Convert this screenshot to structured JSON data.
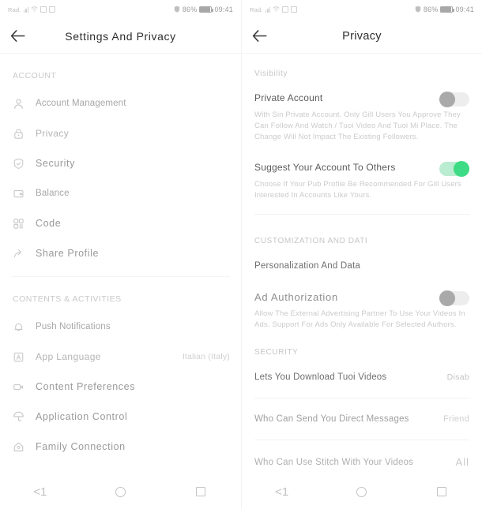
{
  "status_bar": {
    "carrier": "Rad.",
    "battery_percent": "86%",
    "time": "09:41",
    "icons": [
      "signal-bars-icon",
      "wifi-icon",
      "mail-icon",
      "calendar-icon",
      "shield-icon",
      "battery-icon"
    ]
  },
  "settings_screen": {
    "title": "Settings And Privacy",
    "back_icon": "back-arrow-icon",
    "sections": [
      {
        "label": "ACCOUNT",
        "items": [
          {
            "icon": "person-icon",
            "label": "Account Management",
            "value": ""
          },
          {
            "icon": "lock-icon",
            "label": "Privacy",
            "value": ""
          },
          {
            "icon": "shield-check-icon",
            "label": "Security",
            "value": ""
          },
          {
            "icon": "wallet-icon",
            "label": "Balance",
            "value": ""
          },
          {
            "icon": "qr-code-icon",
            "label": "Code",
            "value": ""
          },
          {
            "icon": "share-arrow-icon",
            "label": "Share Profile",
            "value": ""
          }
        ]
      },
      {
        "label": "CONTENTS & ACTIVITIES",
        "items": [
          {
            "icon": "bell-icon",
            "label": "Push Notifications",
            "value": ""
          },
          {
            "icon": "language-icon",
            "label": "App Language",
            "value": "Italian (Italy)"
          },
          {
            "icon": "video-camera-icon",
            "label": "Content Preferences",
            "value": ""
          },
          {
            "icon": "umbrella-icon",
            "label": "Application Control",
            "value": ""
          },
          {
            "icon": "home-icon",
            "label": "Family Connection",
            "value": ""
          }
        ]
      }
    ]
  },
  "privacy_screen": {
    "title": "Privacy",
    "back_icon": "back-arrow-icon",
    "sections": [
      {
        "label": "Visibility",
        "toggles": [
          {
            "title": "Private Account",
            "description": "With Sin Private Account. Only Gill Users You Approve They Can Follow And Watch / Tuoi Video And Tuoi Mi Place. The Change Will Not Impact The Existing Followers.",
            "state": "off"
          },
          {
            "title": "Suggest Your Account To Others",
            "description": "Choose If Your Pub Profile Be Recommended For Gill Users Interested In Accounts Like Yours.",
            "state": "on"
          }
        ]
      },
      {
        "label": "CUSTOMIZATION AND DATI",
        "items": [
          {
            "label": "Personalization And Data",
            "value": ""
          }
        ],
        "toggles": [
          {
            "title": "Ad Authorization",
            "description": "Allow The External Advertising Partner To Use Your Videos In Ads. Support For Ads Only Available For Selected Authors.",
            "state": "off"
          }
        ]
      },
      {
        "label": "SECURITY",
        "items": [
          {
            "label": "Lets You Download Tuoi Videos",
            "value": "Disab"
          },
          {
            "label": "Who Can Send You Direct Messages",
            "value": "Friend"
          },
          {
            "label": "Who Can Use Stitch With Your Videos",
            "value": "All"
          }
        ]
      }
    ]
  },
  "nav_bar": {
    "back_label": "<1",
    "home_icon": "circle-icon",
    "recents_icon": "square-icon"
  },
  "colors": {
    "toggle_on_track": "#b9ecd0",
    "toggle_on_knob": "#3ddc84",
    "toggle_off_track": "#ededed",
    "toggle_off_knob": "#a9a9a9"
  }
}
